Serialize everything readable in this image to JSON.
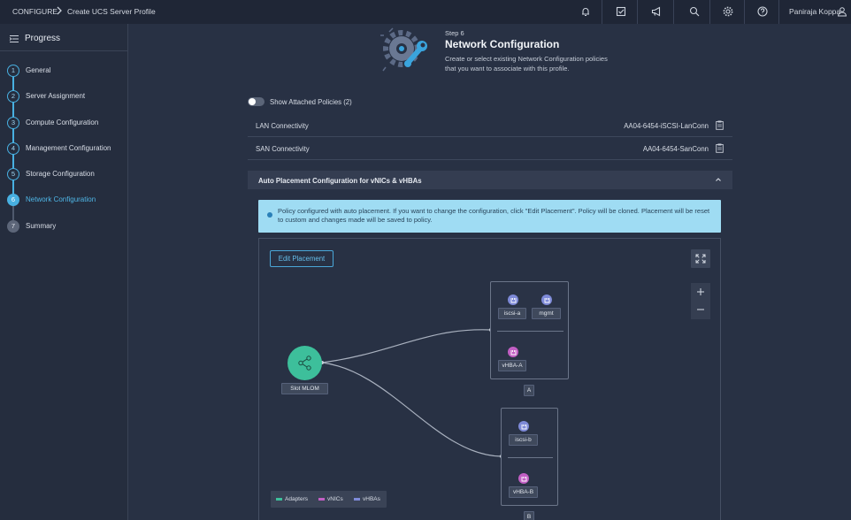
{
  "breadcrumb": {
    "root": "CONFIGURE",
    "current": "Create UCS Server Profile"
  },
  "topbar": {
    "icons": [
      "bell-icon",
      "checklist-icon",
      "megaphone-icon",
      "search-icon",
      "gear-icon",
      "help-icon",
      "user-icon"
    ],
    "user_name": "Paniraja Koppa"
  },
  "sidebar": {
    "title": "Progress",
    "steps": [
      {
        "num": "1",
        "label": "General",
        "state": "done"
      },
      {
        "num": "2",
        "label": "Server Assignment",
        "state": "done"
      },
      {
        "num": "3",
        "label": "Compute Configuration",
        "state": "done"
      },
      {
        "num": "4",
        "label": "Management Configuration",
        "state": "done"
      },
      {
        "num": "5",
        "label": "Storage Configuration",
        "state": "done"
      },
      {
        "num": "6",
        "label": "Network Configuration",
        "state": "active"
      },
      {
        "num": "7",
        "label": "Summary",
        "state": "todo"
      }
    ]
  },
  "header": {
    "step": "Step 6",
    "title": "Network Configuration",
    "description": "Create or select existing Network Configuration policies that you want to associate with this profile."
  },
  "toggle": {
    "label": "Show Attached Policies (2)",
    "on": false
  },
  "policies": [
    {
      "label": "LAN Connectivity",
      "value": "AA04-6454-iSCSI-LanConn"
    },
    {
      "label": "SAN Connectivity",
      "value": "AA04-6454-SanConn"
    }
  ],
  "accordion": {
    "title": "Auto Placement Configuration for vNICs & vHBAs",
    "expanded": true
  },
  "info": {
    "text": "Policy configured with auto placement. If you want to change the configuration, click \"Edit Placement\". Policy will be cloned. Placement will be reset to custom and changes made will be saved to policy."
  },
  "canvas": {
    "edit_button": "Edit Placement",
    "slot": {
      "label": "Slot MLOM"
    },
    "adapters": [
      {
        "label": "A",
        "vnics": [
          "iscsi-a",
          "mgmt"
        ],
        "vhbas": [
          "vHBA-A"
        ]
      },
      {
        "label": "B",
        "vnics": [
          "iscsi-b"
        ],
        "vhbas": [
          "vHBA-B"
        ]
      }
    ],
    "legend": [
      "Adapters",
      "vNICs",
      "vHBAs"
    ]
  },
  "colors": {
    "accent": "#48b0e1",
    "slot": "#3dbf9b",
    "vnic": "#7e8ad8",
    "vhba": "#c25fc4",
    "info_bg": "#9fdcf3"
  }
}
